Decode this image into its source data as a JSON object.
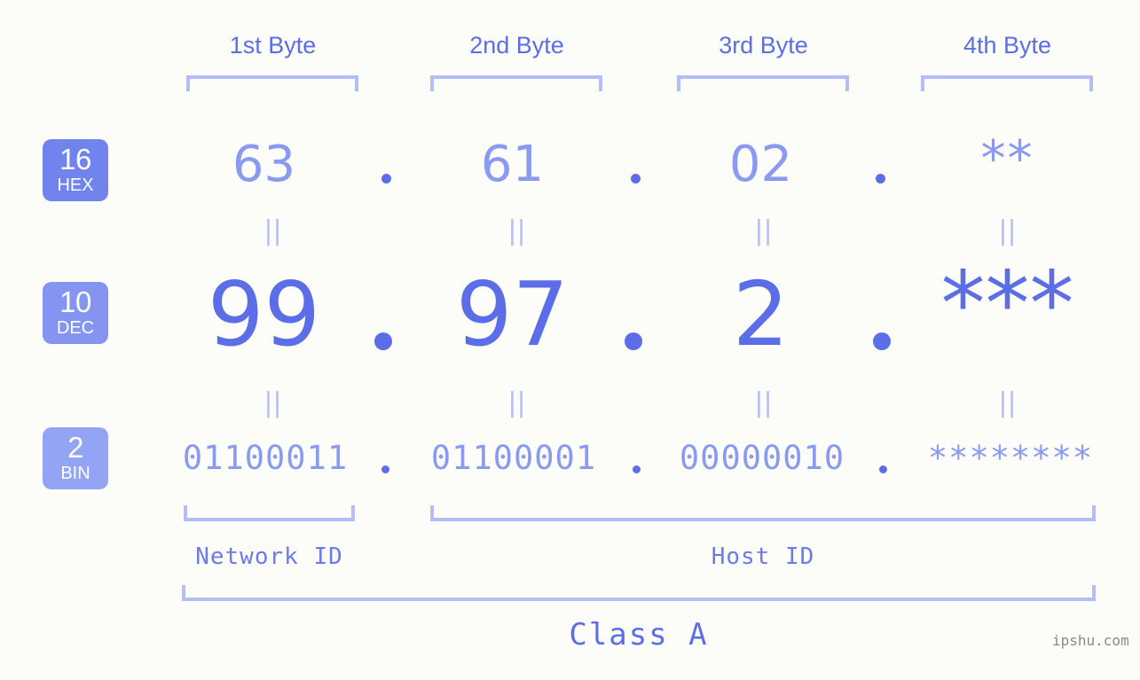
{
  "background_color": "#fcfdf9",
  "accent_colors": {
    "strong_blue": "#5b6ee8",
    "mid_blue": "#8a9af0",
    "light_blue": "#b3bdf7",
    "badge_hex": "#7183ec",
    "badge_dec": "#8494f0",
    "badge_bin": "#93a4f4",
    "watermark_gray": "#8a8a8a"
  },
  "byte_headers": [
    {
      "label": "1st Byte"
    },
    {
      "label": "2nd Byte"
    },
    {
      "label": "3rd Byte"
    },
    {
      "label": "4th Byte"
    }
  ],
  "bases": [
    {
      "number": "16",
      "name": "HEX"
    },
    {
      "number": "10",
      "name": "DEC"
    },
    {
      "number": "2",
      "name": "BIN"
    }
  ],
  "separator": ".",
  "equality_symbol": "||",
  "rows": {
    "hex": {
      "base": "16",
      "base_name": "HEX",
      "values": [
        "63",
        "61",
        "02",
        "**"
      ]
    },
    "dec": {
      "base": "10",
      "base_name": "DEC",
      "values": [
        "99",
        "97",
        "2",
        "***"
      ]
    },
    "bin": {
      "base": "2",
      "base_name": "BIN",
      "values": [
        "01100011",
        "01100001",
        "00000010",
        "********"
      ]
    }
  },
  "segments": {
    "network_id": "Network ID",
    "host_id": "Host ID",
    "class": "Class A"
  },
  "watermark": "ipshu.com"
}
